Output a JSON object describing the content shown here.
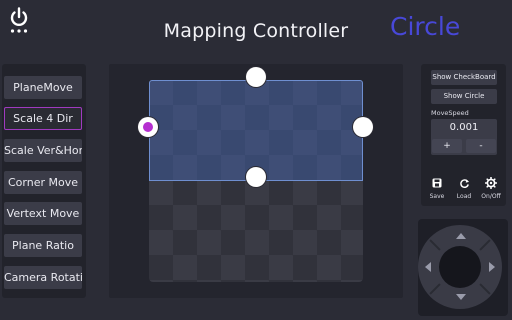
{
  "header": {
    "title": "Mapping Controller",
    "mode_label": "Circle",
    "power_icon": "power-icon"
  },
  "left_menu": {
    "active_index": 1,
    "items": [
      {
        "label": "PlaneMove"
      },
      {
        "label": "Scale 4 Dir"
      },
      {
        "label": "Scale Ver&Hori"
      },
      {
        "label": "Corner Move"
      },
      {
        "label": "Vertext Move"
      },
      {
        "label": "Plane Ratio"
      },
      {
        "label": "Camera Rotation"
      }
    ]
  },
  "right_panel": {
    "show_checkboard_label": "Show CheckBoard",
    "show_circle_label": "Show Circle",
    "move_speed_label": "MoveSpeed",
    "move_speed_value": "0.001",
    "plus_label": "+",
    "minus_label": "-",
    "tools": [
      {
        "label": "Save",
        "icon": "save-icon"
      },
      {
        "label": "Load",
        "icon": "refresh-icon"
      },
      {
        "label": "On/Off",
        "icon": "gear-icon"
      }
    ]
  },
  "canvas": {
    "selected_handle": "left"
  },
  "dpad": {
    "icons": [
      "arrow-up-icon",
      "arrow-down-icon",
      "arrow-left-icon",
      "arrow-right-icon"
    ]
  },
  "colors": {
    "background": "#2b2c36",
    "accent_mode": "#4848d8",
    "active_border": "#a03ac0",
    "selected_handle": "#b52fd0",
    "selection_fill": "#466ec8"
  }
}
